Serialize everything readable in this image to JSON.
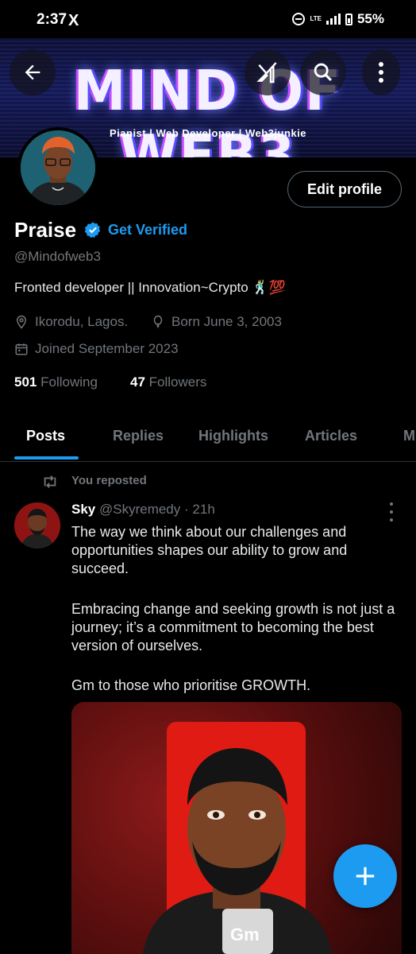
{
  "status_bar": {
    "time": "2:37",
    "x_icon": "X",
    "network": "LTE",
    "battery": "55%"
  },
  "banner": {
    "title": "MIND OF WEB3",
    "subtitle": "Pianist | Web Developer | Web3junkie"
  },
  "profile": {
    "edit_label": "Edit profile",
    "name": "Praise",
    "get_verified": "Get Verified",
    "handle": "@Mindofweb3",
    "bio": "Fronted developer  ||  Innovation~Crypto 🕺💯",
    "location": "Ikorodu, Lagos.",
    "birthday": "Born June 3, 2003",
    "joined": "Joined September 2023",
    "following_count": "501",
    "following_label": "Following",
    "followers_count": "47",
    "followers_label": "Followers"
  },
  "tabs": [
    {
      "label": "Posts",
      "active": true
    },
    {
      "label": "Replies"
    },
    {
      "label": "Highlights"
    },
    {
      "label": "Articles"
    },
    {
      "label": "M"
    }
  ],
  "post": {
    "repost_label": "You reposted",
    "author": "Sky",
    "handle": "@Skyremedy",
    "time": "21h",
    "paragraphs": [
      "The way we think about our challenges and opportunities shapes our ability to grow and succeed.",
      "Embracing change and seeking growth is not just a journey; it’s a commitment to becoming the best version of ourselves.",
      "Gm to those who prioritise GROWTH."
    ],
    "image_caption": "Gm"
  },
  "colors": {
    "accent": "#1d9bf0",
    "background": "#000000",
    "secondary_text": "#71767b"
  }
}
